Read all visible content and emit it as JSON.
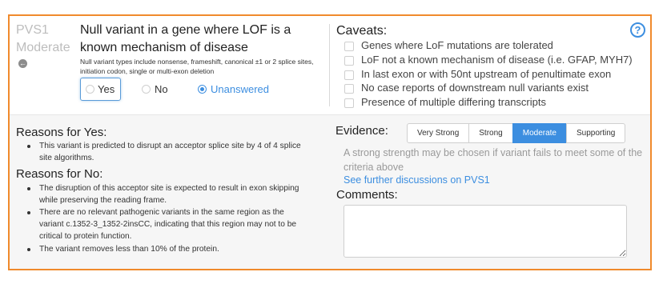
{
  "criterion": {
    "code": "PVS1",
    "strength": "Moderate",
    "back_icon": "arrow-left-circle-icon",
    "title": "Null variant in a gene where LOF is a known mechanism of disease",
    "description": "Null variant types include nonsense, frameshift, canonical ±1 or 2 splice sites, initiation codon, single or multi-exon deletion",
    "options": [
      {
        "label": "Yes",
        "selected": false
      },
      {
        "label": "No",
        "selected": false
      },
      {
        "label": "Unanswered",
        "selected": true
      }
    ]
  },
  "caveats": {
    "title": "Caveats:",
    "help_icon": "question-circle-icon",
    "items": [
      {
        "label": "Genes where LoF mutations are tolerated",
        "checked": false
      },
      {
        "label": "LoF not a known mechanism of disease (i.e. GFAP, MYH7)",
        "checked": false
      },
      {
        "label": "In last exon or with 50nt upstream of penultimate exon",
        "checked": false
      },
      {
        "label": "No case reports of downstream null variants exist",
        "checked": false
      },
      {
        "label": "Presence of multiple differing transcripts",
        "checked": false
      }
    ]
  },
  "reasons": {
    "yes_title": "Reasons for Yes:",
    "yes_items": [
      "This variant is predicted to disrupt an acceptor splice site by 4 of 4 splice site algorithms."
    ],
    "no_title": "Reasons for No:",
    "no_items": [
      "The disruption of this acceptor site is expected to result in exon skipping while preserving the reading frame.",
      "There are no relevant pathogenic variants in the same region as the variant c.1352-3_1352-2insCC, indicating that this region may not to be critical to protein function.",
      "The variant removes less than 10% of the protein."
    ]
  },
  "evidence": {
    "label": "Evidence:",
    "strengths": [
      "Very Strong",
      "Strong",
      "Moderate",
      "Supporting"
    ],
    "selected": "Moderate",
    "note": "A strong strength may be chosen if variant fails to meet some of the criteria above",
    "link": "See further discussions on PVS1"
  },
  "comments": {
    "label": "Comments:",
    "value": ""
  },
  "colors": {
    "panel_border": "#f08a2c",
    "accent": "#3c8ee0",
    "muted_text": "#bdbdbd"
  }
}
